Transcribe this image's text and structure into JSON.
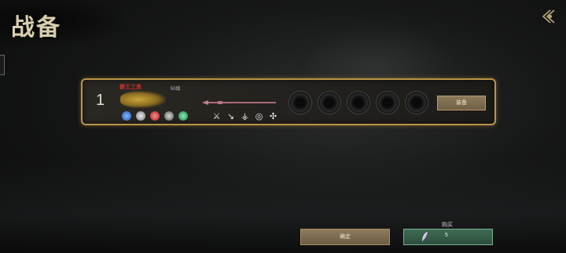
{
  "header": {
    "title": "战备"
  },
  "lineup": {
    "slot_number": "1",
    "hero_name": "霸王之勇",
    "hero_level": "50级",
    "equip_button": "装备"
  },
  "footer": {
    "confirm_button": "确定",
    "buy_label": "购买",
    "buy_price": "5"
  },
  "colors": {
    "gold_border": "#b99445",
    "confirm_bg": "#7c6b50",
    "buy_bg": "#355c47"
  }
}
